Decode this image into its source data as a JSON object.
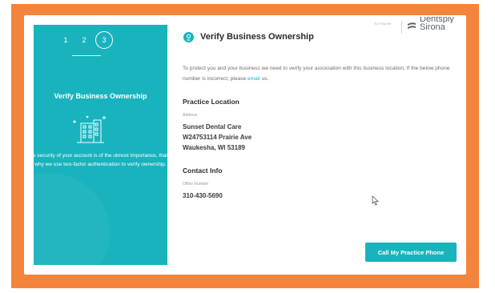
{
  "stepper": {
    "steps": [
      "1",
      "2",
      "3"
    ],
    "active": "3"
  },
  "left_panel": {
    "title": "Verify Business Ownership",
    "description": "he security of your account is of the utmost importance, that's why we use two-factor authentication to verify ownership."
  },
  "header": {
    "title": "Verify Business Ownership",
    "brand_tagline": "TO YOU BY",
    "brand_name_top": "Dentsply",
    "brand_name": "Sirona"
  },
  "intro": {
    "text_before": "To protect you and your business we need to verify your association with this business location. If the below phone number is incorrect, please ",
    "link_text": "email",
    "text_after": " us."
  },
  "practice_location": {
    "section_title": "Practice Location",
    "address_label": "Address",
    "name": "Sunset Dental Care",
    "street": "W24753114 Prairie Ave",
    "city_state_zip": "Waukesha, WI 53189"
  },
  "contact_info": {
    "section_title": "Contact Info",
    "office_label": "Office Number",
    "office_number": "310-430-5690"
  },
  "actions": {
    "call_label": "Call My Practice Phone"
  },
  "colors": {
    "accent": "#18b3bd",
    "frame": "#f2843c"
  }
}
